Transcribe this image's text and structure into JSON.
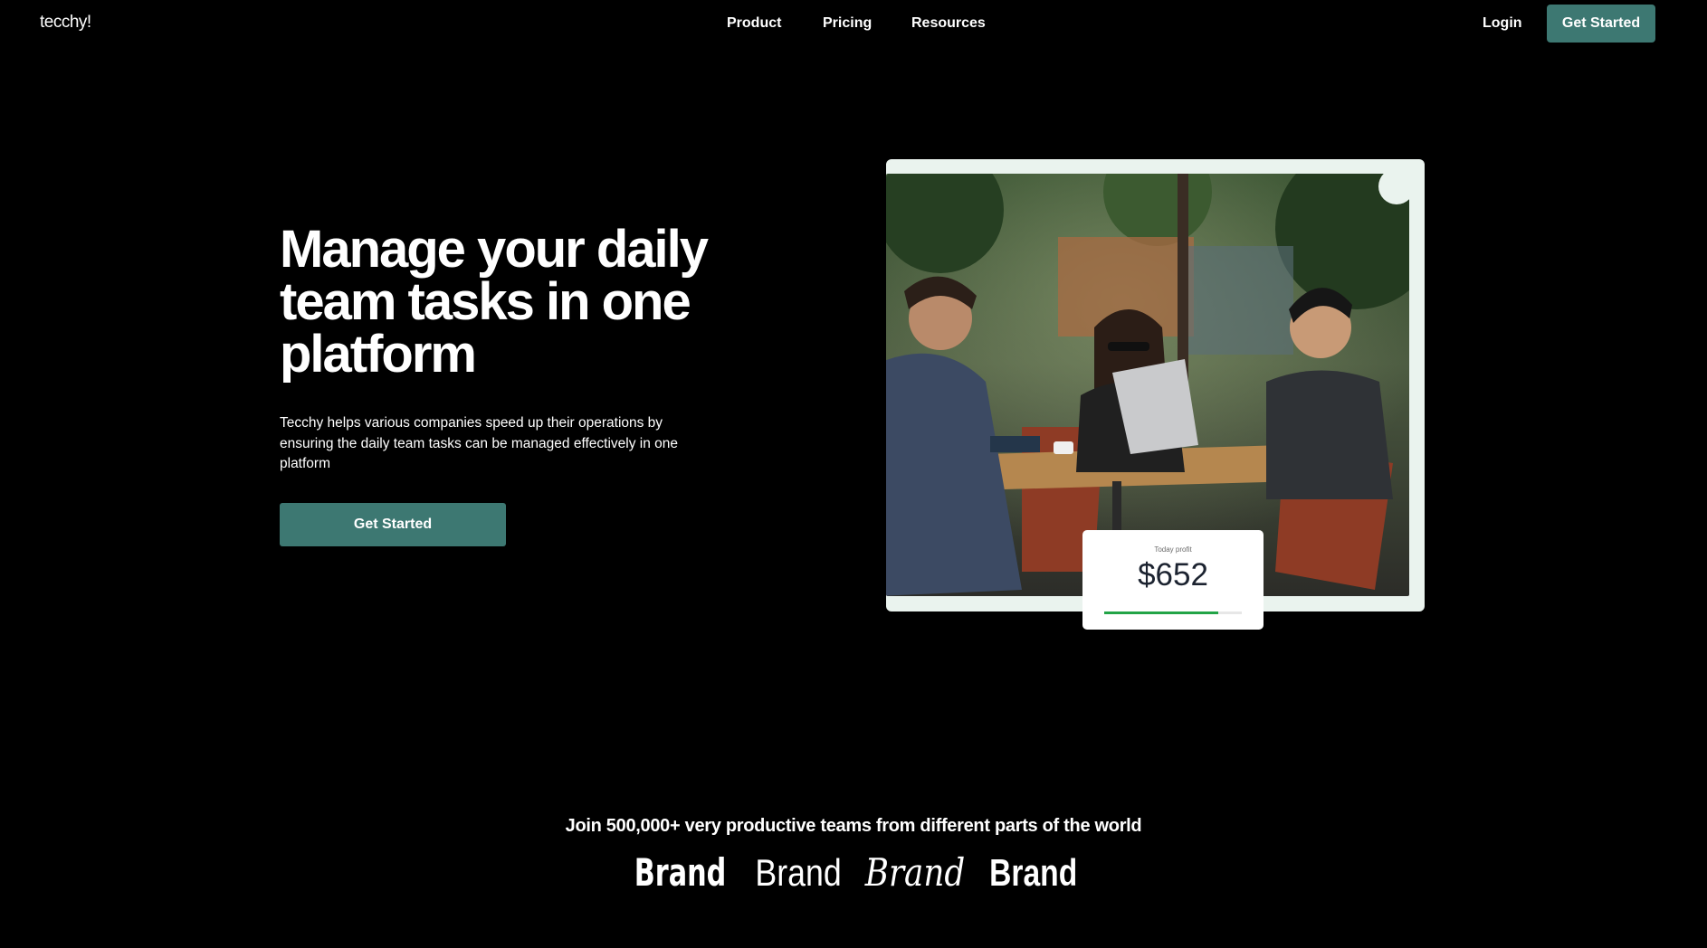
{
  "nav": {
    "logo": "tecchy!",
    "links": [
      "Product",
      "Pricing",
      "Resources"
    ],
    "login": "Login",
    "cta": "Get Started"
  },
  "hero": {
    "title": "Manage your daily team tasks in one platform",
    "description": "Tecchy helps various companies speed up their operations by ensuring the daily team tasks can be managed effectively in one platform",
    "cta": "Get Started"
  },
  "profit_card": {
    "label": "Today profit",
    "value": "$652",
    "progress_fraction": 0.83
  },
  "social_proof": {
    "text": "Join 500,000+ very productive teams from different parts of the world",
    "brands": [
      "Brand",
      "Brand",
      "Brand",
      "Brand"
    ]
  },
  "colors": {
    "background": "#000000",
    "accent": "#3d7872",
    "progress": "#22a447",
    "frame": "#eaf3ee"
  }
}
